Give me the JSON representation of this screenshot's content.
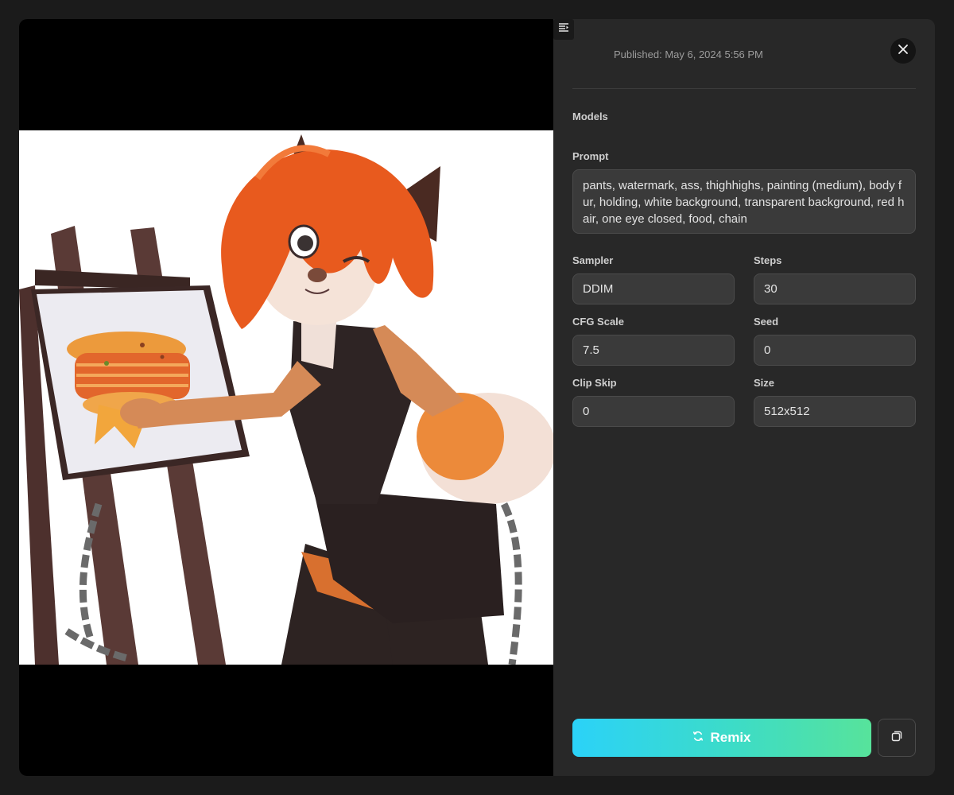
{
  "meta": {
    "published": "Published: May 6, 2024 5:56 PM"
  },
  "sections": {
    "models_label": "Models",
    "prompt_label": "Prompt",
    "prompt_text": "pants, watermark, ass, thighhighs, painting (medium), body fur, holding, white background, transparent background, red hair, one eye closed, food, chain"
  },
  "params": {
    "sampler": {
      "label": "Sampler",
      "value": "DDIM"
    },
    "steps": {
      "label": "Steps",
      "value": "30"
    },
    "cfg_scale": {
      "label": "CFG Scale",
      "value": "7.5"
    },
    "seed": {
      "label": "Seed",
      "value": "0"
    },
    "clip_skip": {
      "label": "Clip Skip",
      "value": "0"
    },
    "size": {
      "label": "Size",
      "value": "512x512"
    }
  },
  "actions": {
    "remix_label": "Remix",
    "remix_icon": "remix-icon",
    "copy_icon": "copy-icon",
    "close_icon": "close-icon",
    "toggle_icon": "panel-toggle-icon"
  },
  "colors": {
    "accent_start": "#2bd2f8",
    "accent_end": "#57e39b",
    "panel_bg": "#282828"
  }
}
